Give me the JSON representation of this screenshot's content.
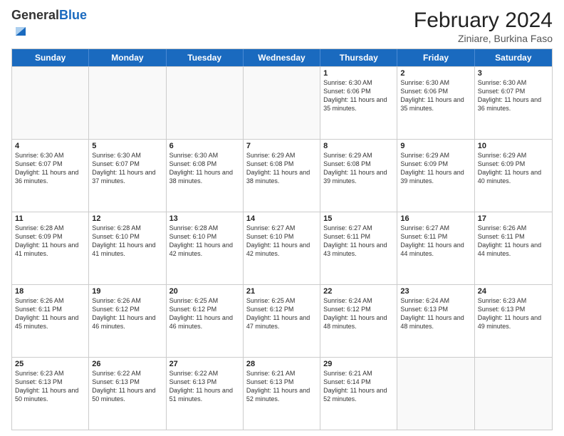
{
  "header": {
    "logo_general": "General",
    "logo_blue": "Blue",
    "main_title": "February 2024",
    "subtitle": "Ziniare, Burkina Faso"
  },
  "days_of_week": [
    "Sunday",
    "Monday",
    "Tuesday",
    "Wednesday",
    "Thursday",
    "Friday",
    "Saturday"
  ],
  "weeks": [
    [
      {
        "day": "",
        "info": ""
      },
      {
        "day": "",
        "info": ""
      },
      {
        "day": "",
        "info": ""
      },
      {
        "day": "",
        "info": ""
      },
      {
        "day": "1",
        "info": "Sunrise: 6:30 AM\nSunset: 6:06 PM\nDaylight: 11 hours and 35 minutes."
      },
      {
        "day": "2",
        "info": "Sunrise: 6:30 AM\nSunset: 6:06 PM\nDaylight: 11 hours and 35 minutes."
      },
      {
        "day": "3",
        "info": "Sunrise: 6:30 AM\nSunset: 6:07 PM\nDaylight: 11 hours and 36 minutes."
      }
    ],
    [
      {
        "day": "4",
        "info": "Sunrise: 6:30 AM\nSunset: 6:07 PM\nDaylight: 11 hours and 36 minutes."
      },
      {
        "day": "5",
        "info": "Sunrise: 6:30 AM\nSunset: 6:07 PM\nDaylight: 11 hours and 37 minutes."
      },
      {
        "day": "6",
        "info": "Sunrise: 6:30 AM\nSunset: 6:08 PM\nDaylight: 11 hours and 38 minutes."
      },
      {
        "day": "7",
        "info": "Sunrise: 6:29 AM\nSunset: 6:08 PM\nDaylight: 11 hours and 38 minutes."
      },
      {
        "day": "8",
        "info": "Sunrise: 6:29 AM\nSunset: 6:08 PM\nDaylight: 11 hours and 39 minutes."
      },
      {
        "day": "9",
        "info": "Sunrise: 6:29 AM\nSunset: 6:09 PM\nDaylight: 11 hours and 39 minutes."
      },
      {
        "day": "10",
        "info": "Sunrise: 6:29 AM\nSunset: 6:09 PM\nDaylight: 11 hours and 40 minutes."
      }
    ],
    [
      {
        "day": "11",
        "info": "Sunrise: 6:28 AM\nSunset: 6:09 PM\nDaylight: 11 hours and 41 minutes."
      },
      {
        "day": "12",
        "info": "Sunrise: 6:28 AM\nSunset: 6:10 PM\nDaylight: 11 hours and 41 minutes."
      },
      {
        "day": "13",
        "info": "Sunrise: 6:28 AM\nSunset: 6:10 PM\nDaylight: 11 hours and 42 minutes."
      },
      {
        "day": "14",
        "info": "Sunrise: 6:27 AM\nSunset: 6:10 PM\nDaylight: 11 hours and 42 minutes."
      },
      {
        "day": "15",
        "info": "Sunrise: 6:27 AM\nSunset: 6:11 PM\nDaylight: 11 hours and 43 minutes."
      },
      {
        "day": "16",
        "info": "Sunrise: 6:27 AM\nSunset: 6:11 PM\nDaylight: 11 hours and 44 minutes."
      },
      {
        "day": "17",
        "info": "Sunrise: 6:26 AM\nSunset: 6:11 PM\nDaylight: 11 hours and 44 minutes."
      }
    ],
    [
      {
        "day": "18",
        "info": "Sunrise: 6:26 AM\nSunset: 6:11 PM\nDaylight: 11 hours and 45 minutes."
      },
      {
        "day": "19",
        "info": "Sunrise: 6:26 AM\nSunset: 6:12 PM\nDaylight: 11 hours and 46 minutes."
      },
      {
        "day": "20",
        "info": "Sunrise: 6:25 AM\nSunset: 6:12 PM\nDaylight: 11 hours and 46 minutes."
      },
      {
        "day": "21",
        "info": "Sunrise: 6:25 AM\nSunset: 6:12 PM\nDaylight: 11 hours and 47 minutes."
      },
      {
        "day": "22",
        "info": "Sunrise: 6:24 AM\nSunset: 6:12 PM\nDaylight: 11 hours and 48 minutes."
      },
      {
        "day": "23",
        "info": "Sunrise: 6:24 AM\nSunset: 6:13 PM\nDaylight: 11 hours and 48 minutes."
      },
      {
        "day": "24",
        "info": "Sunrise: 6:23 AM\nSunset: 6:13 PM\nDaylight: 11 hours and 49 minutes."
      }
    ],
    [
      {
        "day": "25",
        "info": "Sunrise: 6:23 AM\nSunset: 6:13 PM\nDaylight: 11 hours and 50 minutes."
      },
      {
        "day": "26",
        "info": "Sunrise: 6:22 AM\nSunset: 6:13 PM\nDaylight: 11 hours and 50 minutes."
      },
      {
        "day": "27",
        "info": "Sunrise: 6:22 AM\nSunset: 6:13 PM\nDaylight: 11 hours and 51 minutes."
      },
      {
        "day": "28",
        "info": "Sunrise: 6:21 AM\nSunset: 6:13 PM\nDaylight: 11 hours and 52 minutes."
      },
      {
        "day": "29",
        "info": "Sunrise: 6:21 AM\nSunset: 6:14 PM\nDaylight: 11 hours and 52 minutes."
      },
      {
        "day": "",
        "info": ""
      },
      {
        "day": "",
        "info": ""
      }
    ]
  ]
}
